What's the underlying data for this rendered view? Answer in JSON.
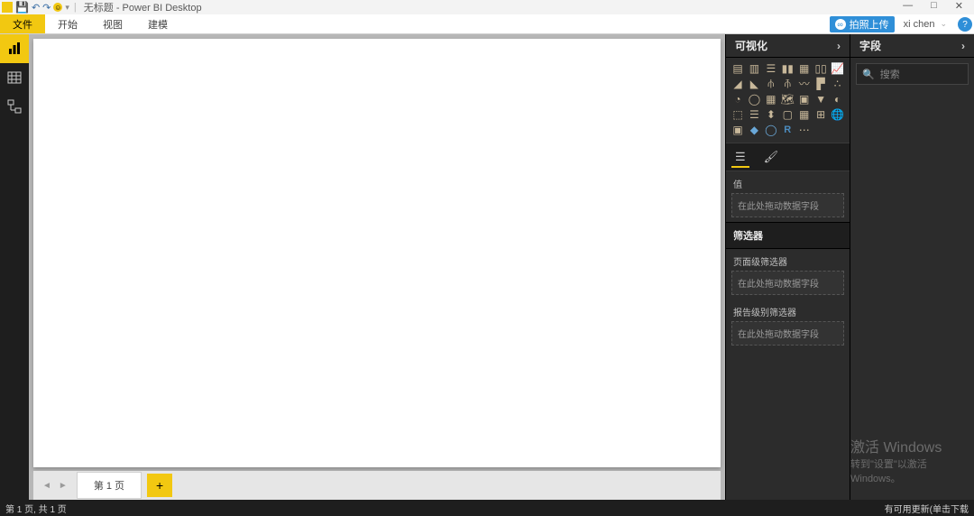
{
  "title": "无标题 - Power BI Desktop",
  "ribbon": {
    "file": "文件",
    "tabs": [
      "开始",
      "视图",
      "建模"
    ],
    "cloud_upload": "拍照上传",
    "user": "xi chen"
  },
  "views": {
    "report": "report",
    "data": "data",
    "model": "model"
  },
  "pages": {
    "page1": "第 1 页",
    "add": "+"
  },
  "viz": {
    "header": "可视化",
    "values_label": "值",
    "drop_hint": "在此处拖动数据字段",
    "filters_header": "筛选器",
    "page_filters_label": "页面级筛选器",
    "report_filters_label": "报告级别筛选器"
  },
  "fields": {
    "header": "字段",
    "search_placeholder": "搜索"
  },
  "watermark": {
    "line1": "激活 Windows",
    "line2": "转到\"设置\"以激活 Windows。"
  },
  "status": {
    "page_info": "第 1 页, 共 1 页",
    "update_hint": "有可用更新(单击下载"
  }
}
